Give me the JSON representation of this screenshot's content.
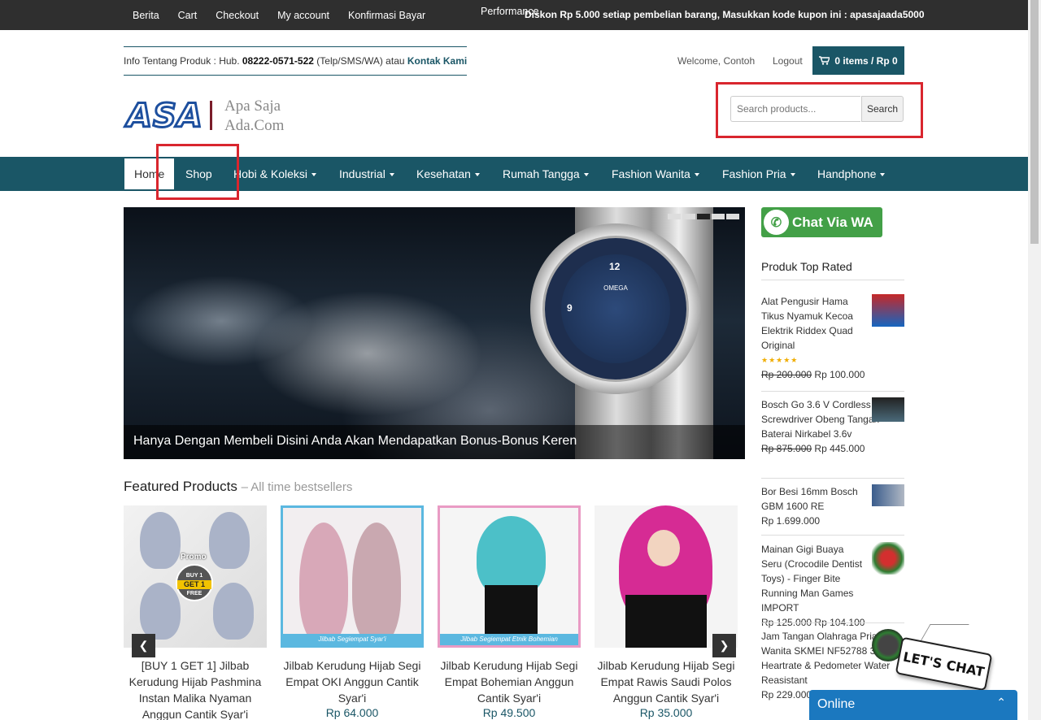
{
  "topbar": {
    "links": [
      "Berita",
      "Cart",
      "Checkout",
      "My account",
      "Konfirmasi Bayar"
    ],
    "perf": "Performance",
    "promo": "Diskon Rp 5.000 setiap pembelian barang, Masukkan kode kupon ini : apasajaada5000"
  },
  "header": {
    "info_prefix": "Info Tentang Produk : Hub. ",
    "phone": "08222-0571-522",
    "info_middle": " (Telp/SMS/WA) atau ",
    "contact_link": "Kontak Kami",
    "welcome": "Welcome, Contoh",
    "logout": "Logout",
    "cart": "0 items / Rp 0",
    "logo_mark": "ASA",
    "logo_line1": "Apa Saja",
    "logo_line2": "Ada.Com",
    "search_placeholder": "Search products...",
    "search_button": "Search"
  },
  "nav": {
    "home": "Home",
    "shop": "Shop",
    "hobi": "Hobi & Koleksi",
    "industrial": "Industrial",
    "kesehatan": "Kesehatan",
    "rumah": "Rumah Tangga",
    "fwanita": "Fashion Wanita",
    "fpria": "Fashion Pria",
    "handphone": "Handphone"
  },
  "slider": {
    "caption": "Hanya Dengan Membeli Disini Anda Akan Mendapatkan Bonus-Bonus Keren",
    "watch_brand": "OMEGA",
    "dial_12": "12",
    "dial_9": "9",
    "active_dot": 2,
    "dot_count": 5
  },
  "featured": {
    "title": "Featured Products",
    "subtitle": "– All time bestsellers",
    "products": [
      {
        "name": "[BUY 1 GET 1] Jilbab Kerudung Hijab Pashmina Instan Malika Nyaman Anggun Cantik Syar'i",
        "price": "",
        "badge_top": "Promo",
        "badge_line1": "BUY 1",
        "badge_line2": "GET 1",
        "badge_line3": "FREE"
      },
      {
        "name": "Jilbab Kerudung Hijab Segi Empat OKI Anggun Cantik Syar'i",
        "price": "Rp 64.000",
        "label": "Jilbab Segiempat Syar'i"
      },
      {
        "name": "Jilbab Kerudung Hijab Segi Empat Bohemian Anggun Cantik Syar'i",
        "price": "Rp 49.500",
        "label": "Jilbab Segiempat Etnik Bohemian"
      },
      {
        "name": "Jilbab Kerudung Hijab Segi Empat Rawis Saudi Polos Anggun Cantik Syar'i",
        "price": "Rp 35.000"
      }
    ]
  },
  "sidebar": {
    "wa": "Chat Via WA",
    "top_rated_title": "Produk Top Rated",
    "items": [
      {
        "name": "Alat Pengusir Hama Tikus Nyamuk Kecoa Elektrik Riddex Quad Original",
        "old_price": "Rp 200.000",
        "price": "Rp 100.000",
        "rating": 5
      },
      {
        "name": "Bosch Go 3.6 V Cordless Screwdriver Obeng Tangan Baterai Nirkabel 3.6v",
        "old_price": "Rp 875.000",
        "price": "Rp 445.000"
      },
      {
        "name": "Bor Besi 16mm Bosch GBM 1600 RE",
        "old_price": "",
        "price": "Rp 1.699.000"
      },
      {
        "name": "Mainan Gigi Buaya Seru (Crocodile Dentist Toys) - Finger Bite Running Man Games IMPORT",
        "old_price": "Rp 125.000",
        "price": "Rp 104.100"
      },
      {
        "name": "Jam Tangan Olahraga Pria Wanita SKMEI NF52788 3D Heartrate & Pedometer Water Reasistant",
        "old_price": "",
        "price": "Rp 229.000"
      }
    ]
  },
  "chat": {
    "sign": "LET'S CHAT",
    "online": "Online"
  }
}
